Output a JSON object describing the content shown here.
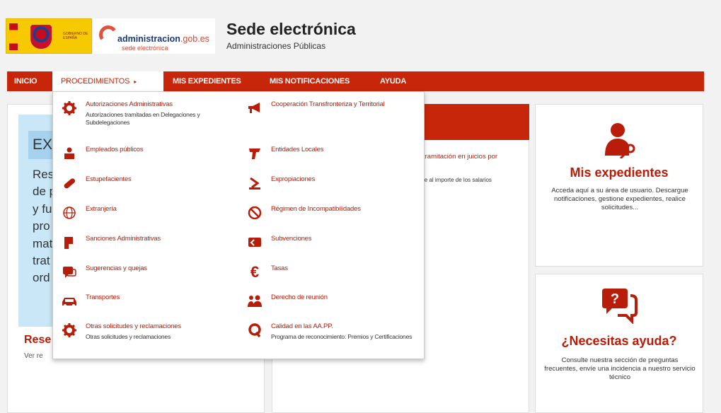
{
  "header": {
    "gov_logo_text": "GOBIERNO DE ESPAÑA",
    "portal_name_main": "administracion",
    "portal_name_domain": ".gob.es",
    "portal_sub": "sede electrónica",
    "title": "Sede electrónica",
    "subtitle": "Administraciones Públicas"
  },
  "nav": {
    "items": [
      {
        "label": "INICIO"
      },
      {
        "label": "PROCEDIMIENTOS",
        "caret": "▸"
      },
      {
        "label": "MIS EXPEDIENTES"
      },
      {
        "label": "MIS NOTIFICACIONES"
      },
      {
        "label": "AYUDA"
      }
    ]
  },
  "dropdown": {
    "left": [
      {
        "label": "Autorizaciones Administrativas",
        "desc": "Autorizaciones tramitadas en Delegaciones y Subdelegaciones",
        "icon": "gear-icon"
      },
      {
        "label": "Empleados públicos",
        "icon": "employee-icon"
      },
      {
        "label": "Estupefacientes",
        "icon": "pill-icon"
      },
      {
        "label": "Extranjería",
        "icon": "globe-icon"
      },
      {
        "label": "Sanciones Administrativas",
        "icon": "sanction-icon"
      },
      {
        "label": "Sugerencias y quejas",
        "icon": "chat-icon"
      },
      {
        "label": "Transportes",
        "icon": "car-icon"
      },
      {
        "label": "Otras solicitudes y reclamaciones",
        "desc": "Otras solicitudes y reclamaciones",
        "icon": "gear-icon"
      }
    ],
    "right": [
      {
        "label": "Cooperación Transfronteriza y Territorial",
        "icon": "megaphone-icon"
      },
      {
        "label": "Entidades Locales",
        "icon": "entity-icon"
      },
      {
        "label": "Expropiaciones",
        "icon": "expropriation-icon"
      },
      {
        "label": "Régimen de Incompatibilidades",
        "icon": "ban-icon"
      },
      {
        "label": "Subvenciones",
        "icon": "subsidy-icon"
      },
      {
        "label": "Tasas",
        "icon": "euro-icon"
      },
      {
        "label": "Derecho de reunión",
        "icon": "group-icon"
      },
      {
        "label": "Calidad en las AA.PP.",
        "desc": "Programa de reconocimiento: Premios y Certificaciones",
        "icon": "quality-icon"
      }
    ]
  },
  "left_panel": {
    "tag": "EX",
    "lines": [
      "Res",
      "de p",
      "y fu",
      "pro",
      "mat",
      "trat",
      "ord"
    ],
    "res_title": "Rese",
    "ver_res": "Ver re"
  },
  "center_panel": {
    "text1": "tramitación en juicios por",
    "text2": "le al importe de los salarios"
  },
  "right_cards": {
    "expedientes": {
      "title": "Mis expedientes",
      "desc": "Acceda aquí a su área de usuario. Descargue notificaciones, gestione expedientes, realice solicitudes..."
    },
    "ayuda": {
      "title": "¿Necesitas ayuda?",
      "desc": "Consulte nuestra sección de preguntas frecuentes, envíe una incidencia a nuestro servicio técnico"
    }
  },
  "colors": {
    "brand": "#c7260a",
    "accent_text": "#b71d08"
  }
}
